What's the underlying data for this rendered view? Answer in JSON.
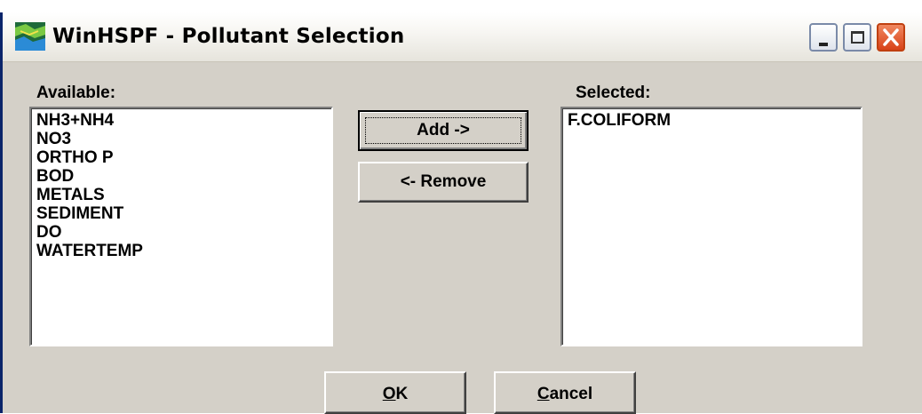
{
  "window": {
    "title": "WinHSPF - Pollutant Selection",
    "icon": "winhspf-app-icon",
    "controls": [
      "minimize-icon",
      "maximize-icon",
      "close-icon"
    ]
  },
  "available": {
    "label": "Available:",
    "items": [
      "NH3+NH4",
      "NO3",
      "ORTHO P",
      "BOD",
      "METALS",
      "SEDIMENT",
      "DO",
      "WATERTEMP"
    ]
  },
  "selected": {
    "label": "Selected:",
    "items": [
      "F.COLIFORM"
    ]
  },
  "buttons": {
    "add": "Add ->",
    "remove": "<- Remove",
    "ok_mnemonic": "O",
    "ok_rest": "K",
    "cancel_mnemonic": "C",
    "cancel_rest": "ancel"
  },
  "colors": {
    "face": "#d4d0c8",
    "close_button": "#d84218",
    "title_text": "#000000"
  }
}
